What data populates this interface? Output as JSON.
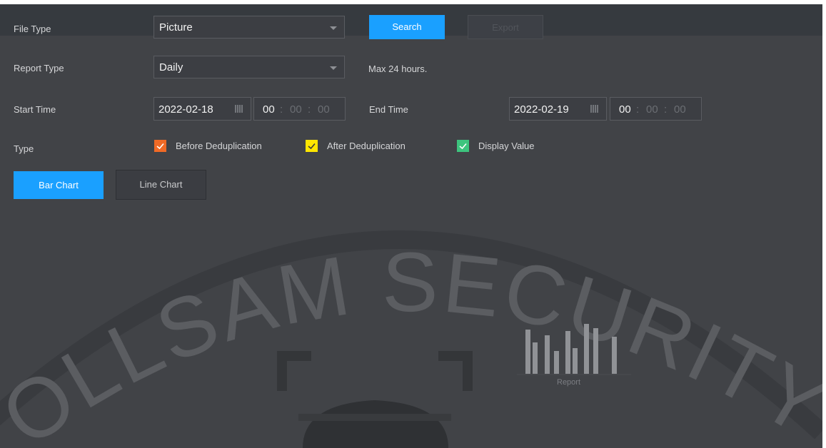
{
  "header": {
    "file_type_label": "File Type",
    "file_type_value": "Picture",
    "search_label": "Search",
    "export_label": "Export"
  },
  "report": {
    "label": "Report Type",
    "value": "Daily",
    "hint": "Max 24 hours."
  },
  "time": {
    "start_label": "Start Time",
    "start_date": "2022-02-18",
    "start_hh": "00",
    "start_mm": "00",
    "start_ss": "00",
    "end_label": "End Time",
    "end_date": "2022-02-19",
    "end_hh": "00",
    "end_mm": "00",
    "end_ss": "00",
    "separator": ":"
  },
  "type": {
    "label": "Type",
    "options": [
      {
        "label": "Before Deduplication",
        "color": "#f06a26",
        "checked": true
      },
      {
        "label": "After Deduplication",
        "color": "#ffe600",
        "checked": true
      },
      {
        "label": "Display Value",
        "color": "#3dc47e",
        "checked": true
      }
    ]
  },
  "view": {
    "bar_chart_label": "Bar Chart",
    "line_chart_label": "Line Chart",
    "active": "Bar Chart"
  },
  "empty_state": {
    "caption": "Report",
    "icon": "report-bars-icon"
  },
  "watermark": {
    "text": "OLLSAM SECURITY",
    "icon": "dome-camera-icon"
  },
  "colors": {
    "panel_bg": "#414347",
    "accent": "#1aa0ff"
  }
}
